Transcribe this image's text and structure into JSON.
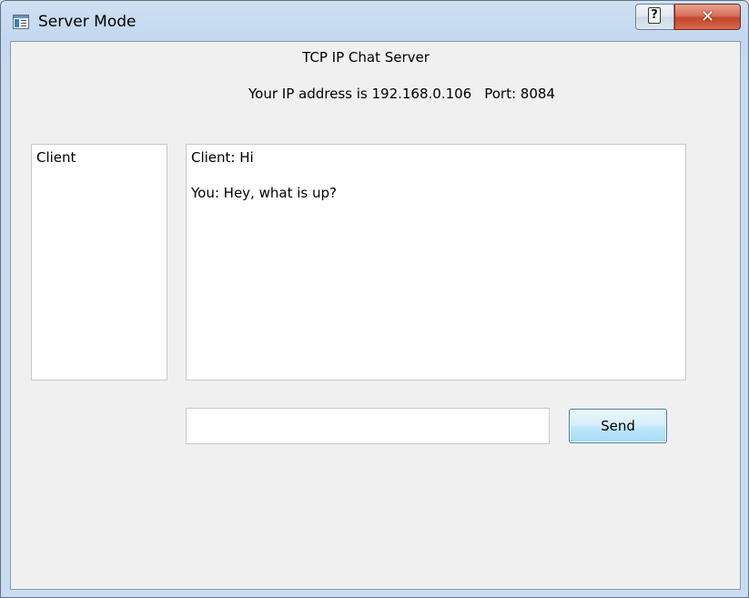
{
  "window": {
    "title": "Server Mode",
    "help_glyph": "?",
    "close_glyph": "✕",
    "icons": [
      "app-window-icon",
      "help-icon",
      "close-icon"
    ]
  },
  "server": {
    "heading": "TCP IP Chat Server",
    "ip_label": "Your IP address is 192.168.0.106",
    "port_label": "Port: 8084"
  },
  "clients": {
    "items": [
      "Client"
    ]
  },
  "chat": {
    "messages": [
      "Client: Hi",
      "You: Hey, what is up?"
    ]
  },
  "composer": {
    "value": "",
    "placeholder": "",
    "send_label": "Send"
  },
  "colors": {
    "accent_border": "#3c7fb1",
    "close_red": "#c4452a",
    "window_bg": "#f0f0f0"
  }
}
